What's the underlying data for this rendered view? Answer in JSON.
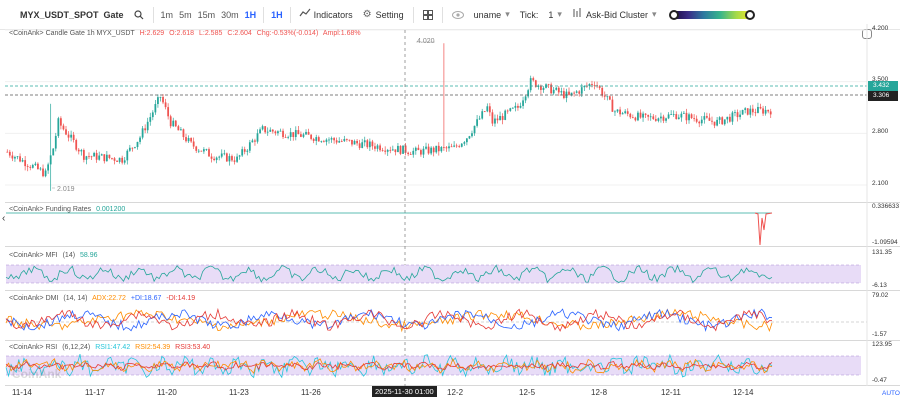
{
  "toolbar": {
    "symbol": "MYX_USDT_SPOT",
    "exchange": "Gate",
    "search_icon": "search-icon",
    "timeframes": [
      "1m",
      "5m",
      "15m",
      "30m",
      "1H"
    ],
    "active_timeframe": "1H",
    "interval_dropdown": "1H",
    "indicators_label": "Indicators",
    "setting_label": "Setting",
    "layout_icon": "grid-icon",
    "eye_icon": "eye-icon",
    "user_label": "uname",
    "tick_label": "Tick:",
    "tick_value": "1",
    "cluster_label": "Ask-Bid Cluster",
    "gradient_colors": [
      "#1a0a3c",
      "#3a2c86",
      "#2d7aa0",
      "#37b48c",
      "#a3d94b",
      "#f6e926"
    ]
  },
  "panes": {
    "candle": {
      "legend": "<CoinAnk> Candle  Gate 1h MYX_USDT",
      "h": "H:2.629",
      "o": "O:2.618",
      "l": "L:2.585",
      "c": "C:2.604",
      "chg": "Chg:-0.53%(-0.014)",
      "ampl": "Ampl:1.68%",
      "axis": [
        "4.200",
        "3.500",
        "2.800",
        "2.100"
      ],
      "high_marker": "4.020",
      "low_marker": "2.019",
      "tag_upper": "3.432",
      "tag_lower": "3.306"
    },
    "funding": {
      "legend": "<CoinAnk> Funding Rates",
      "value": "0.001200",
      "axis": [
        "0.336633",
        "-1.09594"
      ]
    },
    "mfi": {
      "legend": "<CoinAnk> MFI",
      "params": "(14)",
      "value": "58.96",
      "axis": [
        "131.35",
        "-6.13"
      ]
    },
    "dmi": {
      "legend": "<CoinAnk> DMI",
      "params": "(14, 14)",
      "adx": "ADX:22.72",
      "pdi": "+DI:18.67",
      "mdi": "-DI:14.19",
      "axis": [
        "79.02",
        "-1.57"
      ]
    },
    "rsi": {
      "legend": "<CoinAnk> RSI",
      "params": "(6,12,24)",
      "rsi1": "RSI1:47.42",
      "rsi2": "RSI2:54.39",
      "rsi3": "RSI3:53.40",
      "axis": [
        "123.95",
        "-0.47"
      ]
    }
  },
  "time_axis": {
    "labels": [
      "11-14",
      "11-17",
      "11-20",
      "11-23",
      "11-26",
      "12-2",
      "12-5",
      "12-8",
      "12-11",
      "12-14"
    ],
    "crosshair": "2025-11-30 01:00",
    "auto": "AUTO"
  },
  "watermark": "CoinAnk",
  "colors": {
    "up": "#26a69a",
    "down": "#ef5350",
    "adx": "#ff8c00",
    "pdi": "#2962ff",
    "mdi": "#e53935",
    "mfi": "#26a69a",
    "band": "#e8dcf7",
    "tag_green": "#26a69a",
    "tag_dark": "#222222"
  }
}
